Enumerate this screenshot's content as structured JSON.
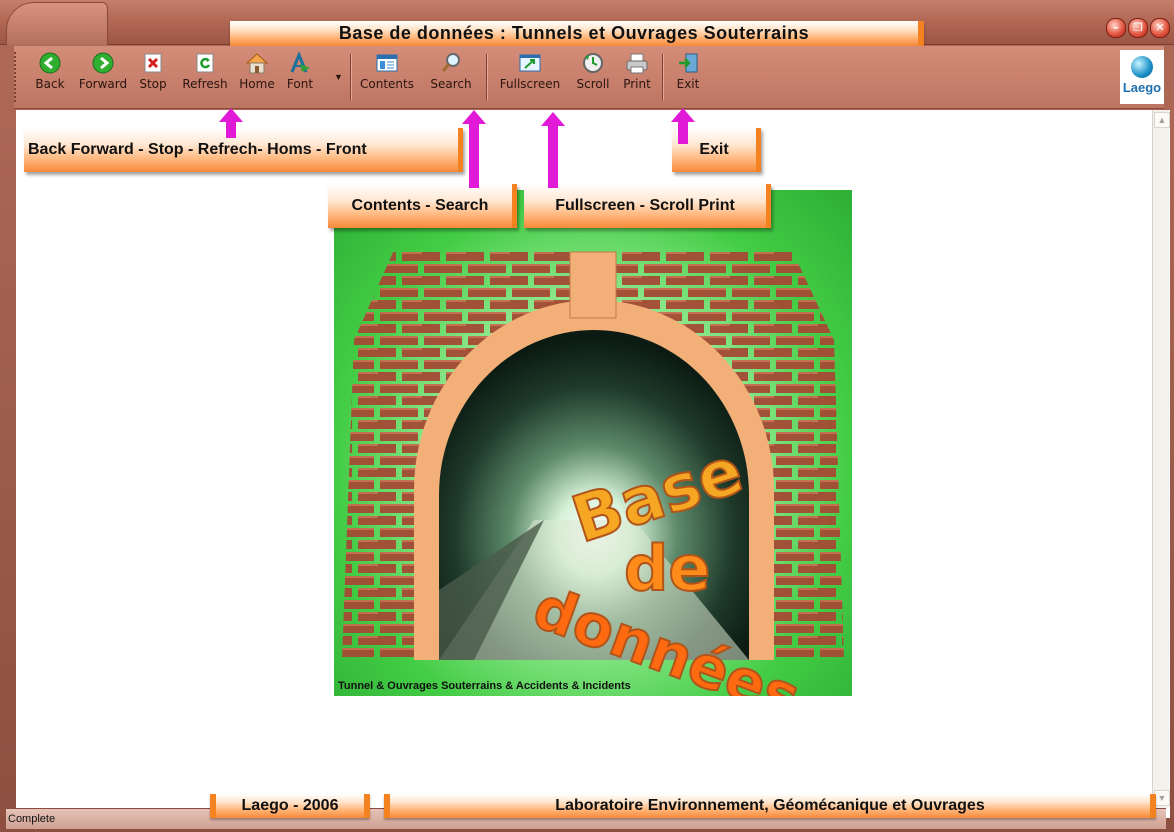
{
  "window": {
    "title": "Base de données : Tunnels et Ouvrages Souterrains",
    "controls": [
      "minimize",
      "restore",
      "close"
    ]
  },
  "toolbar": {
    "buttons": [
      {
        "label": "Back",
        "icon": "back-arrow-icon"
      },
      {
        "label": "Forward",
        "icon": "forward-arrow-icon"
      },
      {
        "label": "Stop",
        "icon": "stop-icon"
      },
      {
        "label": "Refresh",
        "icon": "refresh-icon"
      },
      {
        "label": "Home",
        "icon": "home-icon"
      },
      {
        "label": "Font",
        "icon": "font-icon"
      },
      {
        "label": "Contents",
        "icon": "contents-icon"
      },
      {
        "label": "Search",
        "icon": "search-icon"
      },
      {
        "label": "Fullscreen",
        "icon": "fullscreen-icon"
      },
      {
        "label": "Scroll",
        "icon": "scroll-icon"
      },
      {
        "label": "Print",
        "icon": "print-icon"
      },
      {
        "label": "Exit",
        "icon": "exit-icon"
      }
    ],
    "logo_text": "Laego"
  },
  "callouts": {
    "nav": "Back Forward - Stop -  Refrech- Homs - Front",
    "exit": "Exit",
    "contents_search": "Contents - Search",
    "fullscreen": "Fullscreen - Scroll  Print"
  },
  "image": {
    "title_word1": "Base",
    "title_word2": "de",
    "title_word3": "données",
    "caption": "Tunnel & Ouvrages Souterrains & Accidents & Incidents"
  },
  "status": {
    "text": "Complete"
  },
  "footer": {
    "left": "Laego - 2006",
    "right": "Laboratoire Environnement, Géomécanique et Ouvrages"
  },
  "colors": {
    "frame": "#b06a58",
    "banner_orange": "#f58220",
    "arrow_magenta": "#e11ad8",
    "image_green": "#43cc45"
  }
}
